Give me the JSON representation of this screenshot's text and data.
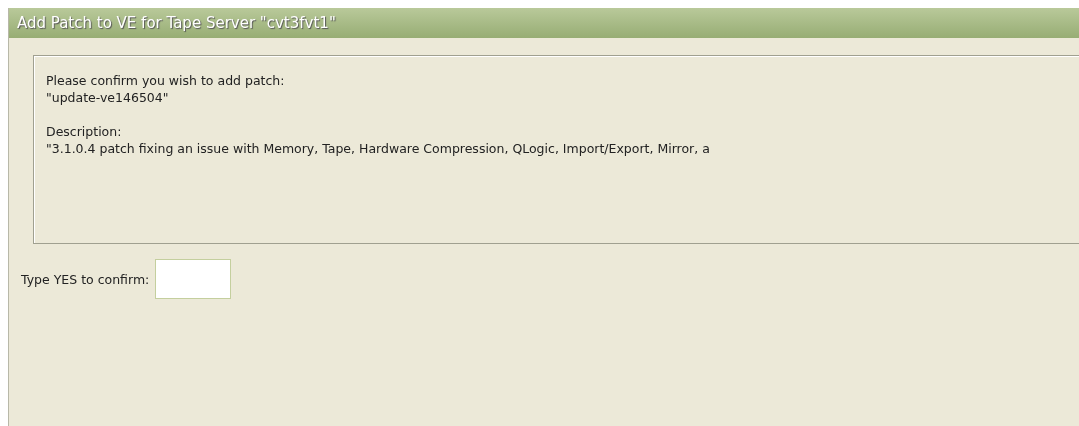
{
  "window": {
    "title": "Add Patch to VE for Tape Server \"cvt3fvt1\""
  },
  "confirmation": {
    "prompt": "Please confirm you wish to add patch:",
    "patch_name": "\"update-ve146504\"",
    "description_label": "Description:",
    "description": "\"3.1.0.4 patch fixing an issue with Memory, Tape, Hardware Compression, QLogic, Import/Export, Mirror, a"
  },
  "confirm_field": {
    "label": "Type YES to confirm:"
  }
}
